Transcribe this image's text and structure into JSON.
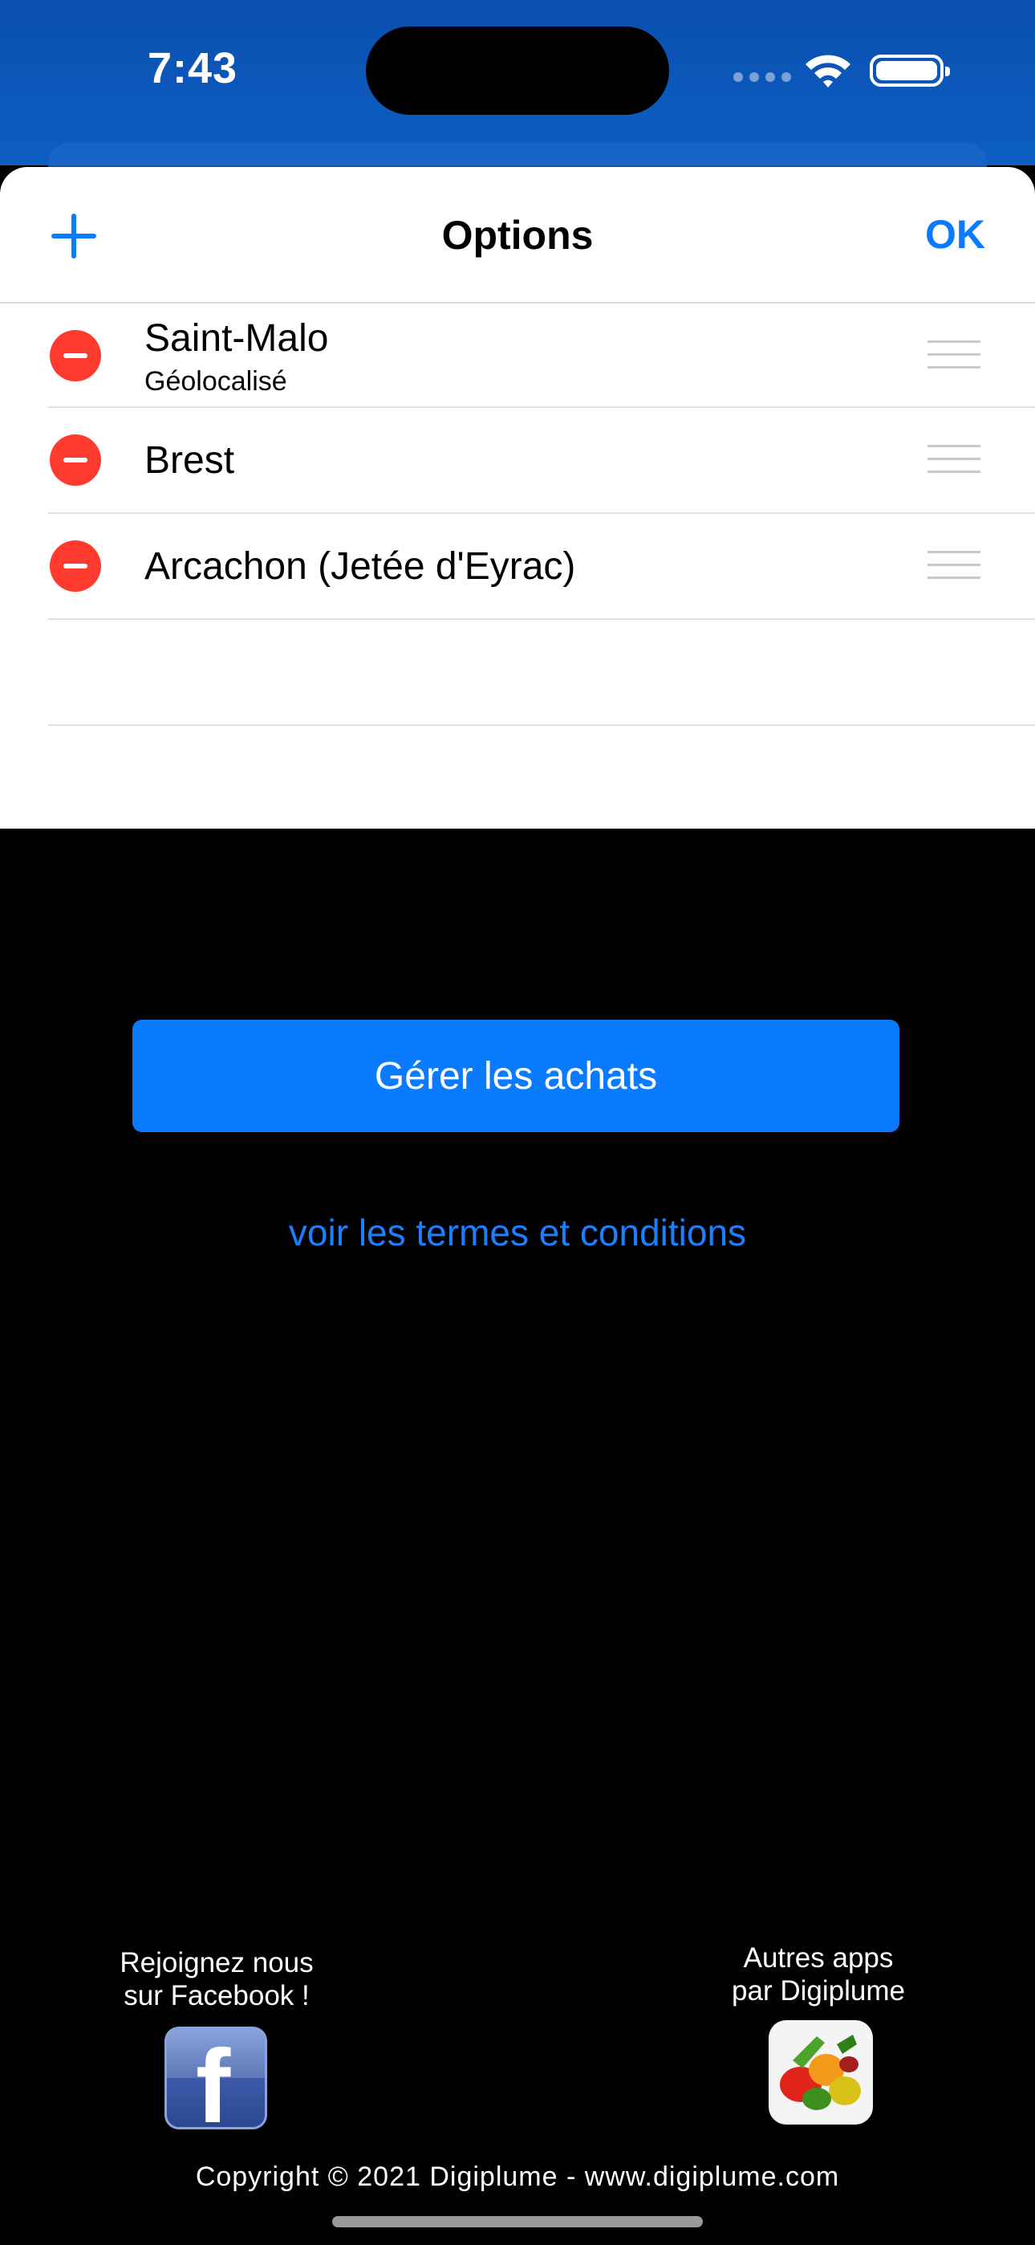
{
  "status_bar": {
    "time": "7:43"
  },
  "nav": {
    "title": "Options",
    "ok_label": "OK"
  },
  "locations": [
    {
      "name": "Saint-Malo",
      "subtitle": "Géolocalisé"
    },
    {
      "name": "Brest"
    },
    {
      "name": "Arcachon (Jetée d'Eyrac)"
    }
  ],
  "actions": {
    "manage_label": "Gérer les achats",
    "terms_label": "voir les termes et conditions"
  },
  "footer": {
    "facebook_line1": "Rejoignez nous",
    "facebook_line2": "sur Facebook !",
    "other_apps_line1": "Autres apps",
    "other_apps_line2": "par Digiplume",
    "copyright": "Copyright © 2021 Digiplume - www.digiplume.com"
  },
  "colors": {
    "accent": "#0a7aff",
    "delete": "#ff3b30",
    "status_bar": "#0d5fc4"
  },
  "icons": [
    "add-icon",
    "delete-icon",
    "reorder-handle-icon",
    "wifi-icon",
    "battery-icon",
    "facebook-icon",
    "digiplume-apps-icon"
  ]
}
